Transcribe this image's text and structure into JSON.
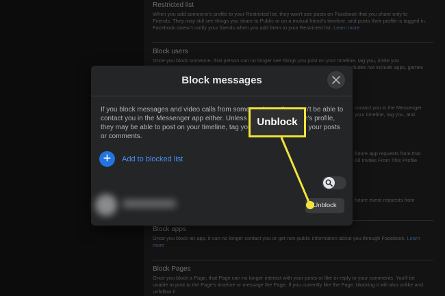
{
  "background_page": {
    "sections": [
      {
        "heading": "Restricted list",
        "text": "When you add someone's profile to your Restricted list, they won't see posts on Facebook that you share only to Friends. They may still see things you share to Public or on a mutual friend's timeline, and posts their profile is tagged in. Facebook doesn't notify your friends when you add them to your Restricted list.",
        "link": "Learn more"
      },
      {
        "heading": "Block users",
        "text": "Once you block someone, that person can no longer see things you post on your timeline, tag you, invite you",
        "text2": "cludes not include apps, games"
      },
      {
        "heading": "Block apps",
        "text": "Once you block an app, it can no longer contact you or get non-public information about you through Facebook.",
        "link": "Learn more"
      },
      {
        "heading": "Block Pages",
        "text": "Once you block a Page, that Page can no longer interact with your posts or like or reply to your comments. You'll be unable to post to the Page's timeline or message the Page. If you currently like the Page, blocking it will also unlike and unfollow it."
      }
    ],
    "fragments": [
      "contact you in the Messenger",
      "your timeline, tag you, and",
      "future app requests from that",
      "All Invites From This Profile",
      "future event requests from"
    ]
  },
  "modal": {
    "title": "Block messages",
    "description": "If you block messages and video calls from someone here, they won't be able to contact you in the Messenger app either. Unless you block someone's profile, they may be able to post on your timeline, tag you, and comment on your posts or comments.",
    "add_button_label": "Add to blocked list",
    "unblock_label": "Unblock"
  },
  "annotation": {
    "callout_text": "Unblock",
    "color": "#f1e23c"
  },
  "icons": {
    "close": "close-icon",
    "add": "plus-icon",
    "search": "search-icon"
  }
}
